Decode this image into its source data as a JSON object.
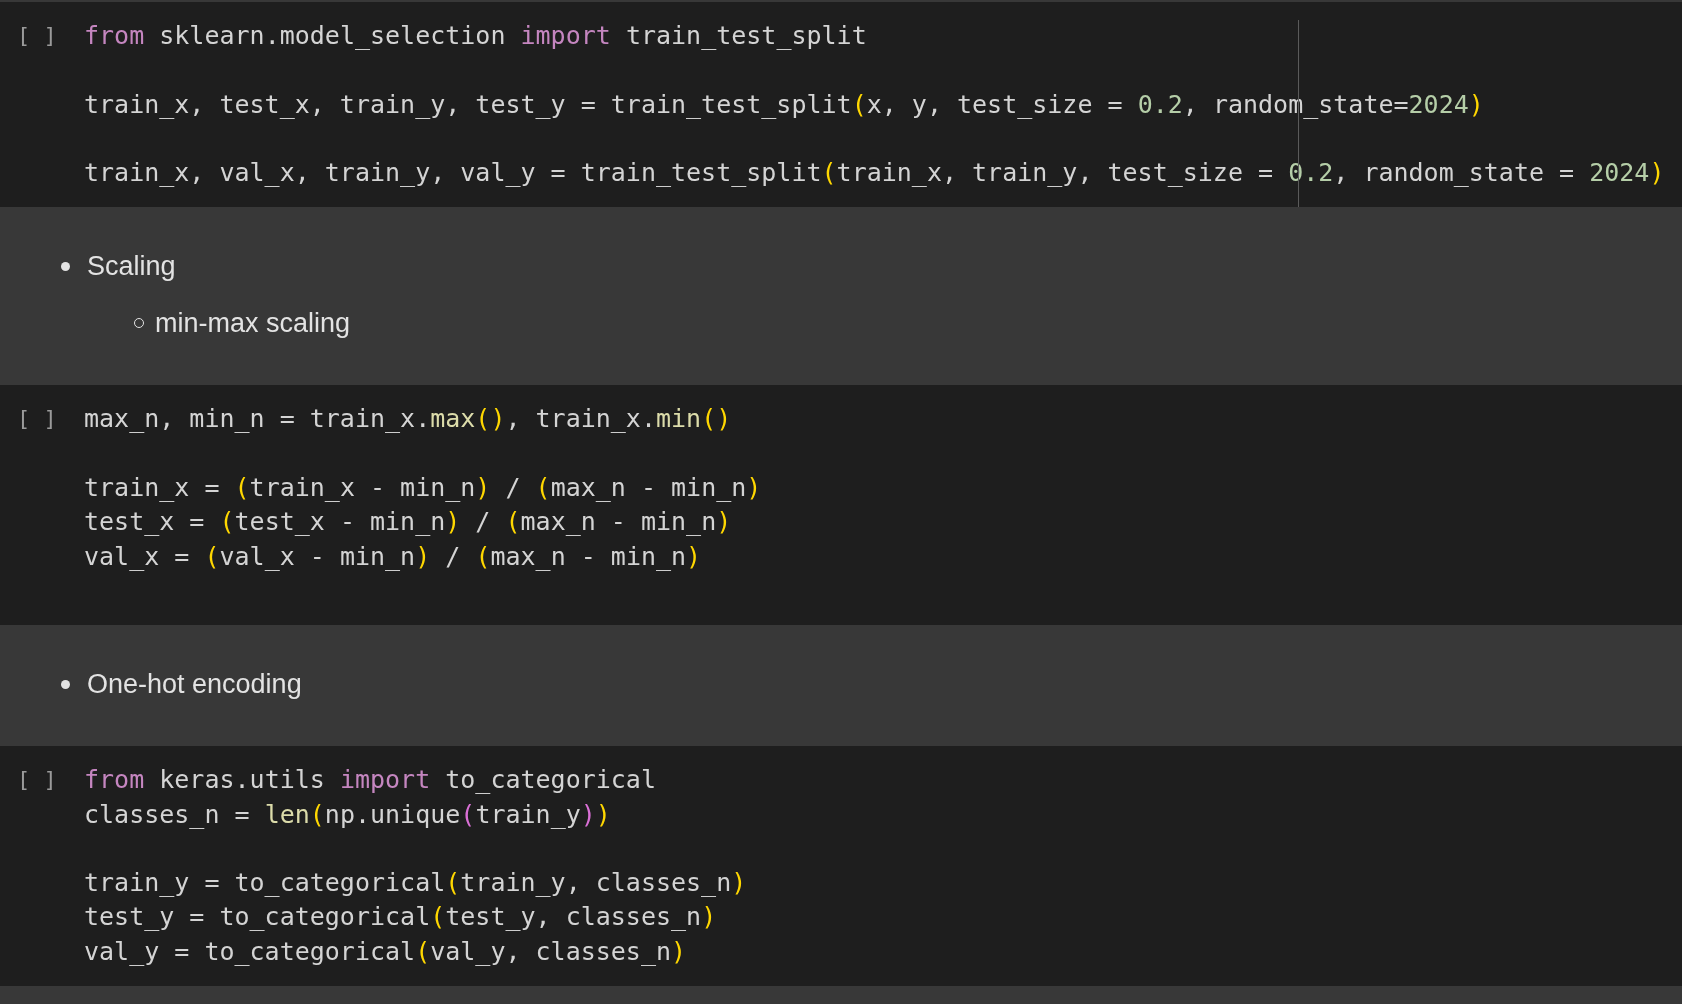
{
  "cells": [
    {
      "kind": "code",
      "run_marker": "[ ]",
      "ruler": true,
      "lines": [
        {
          "kind": "code",
          "tokens": [
            {
              "kind": "keyword",
              "text": "from"
            },
            {
              "kind": "plain",
              "text": " sklearn.model_selection "
            },
            {
              "kind": "keyword",
              "text": "import"
            },
            {
              "kind": "plain",
              "text": " train_test_split"
            }
          ]
        },
        {
          "kind": "blank"
        },
        {
          "kind": "code",
          "tokens": [
            {
              "kind": "plain",
              "text": "train_x, test_x, train_y, test_y = train_test_split"
            },
            {
              "kind": "bracket",
              "text": "("
            },
            {
              "kind": "plain",
              "text": "x, y, test_size = "
            },
            {
              "kind": "number",
              "text": "0.2"
            },
            {
              "kind": "plain",
              "text": ", random_state="
            },
            {
              "kind": "number",
              "text": "2024"
            },
            {
              "kind": "bracket",
              "text": ")"
            }
          ]
        },
        {
          "kind": "blank"
        },
        {
          "kind": "code",
          "tokens": [
            {
              "kind": "plain",
              "text": "train_x, val_x, train_y, val_y = train_test_split"
            },
            {
              "kind": "bracket",
              "text": "("
            },
            {
              "kind": "plain",
              "text": "train_x, train_y, test_size = "
            },
            {
              "kind": "number",
              "text": "0.2"
            },
            {
              "kind": "plain",
              "text": ", random_state = "
            },
            {
              "kind": "number",
              "text": "2024"
            },
            {
              "kind": "bracket",
              "text": ")"
            }
          ]
        }
      ]
    },
    {
      "kind": "markdown",
      "bullets": [
        {
          "text": "Scaling",
          "children": [
            {
              "text": "min-max scaling"
            }
          ]
        }
      ]
    },
    {
      "kind": "code",
      "run_marker": "[ ]",
      "ruler": false,
      "lines": [
        {
          "kind": "code",
          "tokens": [
            {
              "kind": "plain",
              "text": "max_n, min_n = train_x."
            },
            {
              "kind": "function",
              "text": "max"
            },
            {
              "kind": "bracket",
              "text": "()"
            },
            {
              "kind": "plain",
              "text": ", train_x."
            },
            {
              "kind": "function",
              "text": "min"
            },
            {
              "kind": "bracket",
              "text": "()"
            }
          ]
        },
        {
          "kind": "blank"
        },
        {
          "kind": "code",
          "tokens": [
            {
              "kind": "plain",
              "text": "train_x = "
            },
            {
              "kind": "bracket",
              "text": "("
            },
            {
              "kind": "plain",
              "text": "train_x - min_n"
            },
            {
              "kind": "bracket",
              "text": ")"
            },
            {
              "kind": "plain",
              "text": " / "
            },
            {
              "kind": "bracket",
              "text": "("
            },
            {
              "kind": "plain",
              "text": "max_n - min_n"
            },
            {
              "kind": "bracket",
              "text": ")"
            }
          ]
        },
        {
          "kind": "code",
          "tokens": [
            {
              "kind": "plain",
              "text": "test_x = "
            },
            {
              "kind": "bracket",
              "text": "("
            },
            {
              "kind": "plain",
              "text": "test_x - min_n"
            },
            {
              "kind": "bracket",
              "text": ")"
            },
            {
              "kind": "plain",
              "text": " / "
            },
            {
              "kind": "bracket",
              "text": "("
            },
            {
              "kind": "plain",
              "text": "max_n - min_n"
            },
            {
              "kind": "bracket",
              "text": ")"
            }
          ]
        },
        {
          "kind": "code",
          "tokens": [
            {
              "kind": "plain",
              "text": "val_x = "
            },
            {
              "kind": "bracket",
              "text": "("
            },
            {
              "kind": "plain",
              "text": "val_x - min_n"
            },
            {
              "kind": "bracket",
              "text": ")"
            },
            {
              "kind": "plain",
              "text": " / "
            },
            {
              "kind": "bracket",
              "text": "("
            },
            {
              "kind": "plain",
              "text": "max_n - min_n"
            },
            {
              "kind": "bracket",
              "text": ")"
            }
          ]
        },
        {
          "kind": "blank"
        }
      ]
    },
    {
      "kind": "markdown",
      "bullets": [
        {
          "text": "One-hot encoding"
        }
      ]
    },
    {
      "kind": "code",
      "run_marker": "[ ]",
      "ruler": false,
      "lines": [
        {
          "kind": "code",
          "tokens": [
            {
              "kind": "keyword",
              "text": "from"
            },
            {
              "kind": "plain",
              "text": " keras.utils "
            },
            {
              "kind": "keyword",
              "text": "import"
            },
            {
              "kind": "plain",
              "text": " to_categorical"
            }
          ]
        },
        {
          "kind": "code",
          "tokens": [
            {
              "kind": "plain",
              "text": "classes_n = "
            },
            {
              "kind": "function",
              "text": "len"
            },
            {
              "kind": "bracket",
              "text": "("
            },
            {
              "kind": "plain",
              "text": "np.unique"
            },
            {
              "kind": "bracket2",
              "text": "("
            },
            {
              "kind": "plain",
              "text": "train_y"
            },
            {
              "kind": "bracket2",
              "text": ")"
            },
            {
              "kind": "bracket",
              "text": ")"
            }
          ]
        },
        {
          "kind": "blank"
        },
        {
          "kind": "code",
          "tokens": [
            {
              "kind": "plain",
              "text": "train_y = to_categorical"
            },
            {
              "kind": "bracket",
              "text": "("
            },
            {
              "kind": "plain",
              "text": "train_y, classes_n"
            },
            {
              "kind": "bracket",
              "text": ")"
            }
          ]
        },
        {
          "kind": "code",
          "tokens": [
            {
              "kind": "plain",
              "text": "test_y = to_categorical"
            },
            {
              "kind": "bracket",
              "text": "("
            },
            {
              "kind": "plain",
              "text": "test_y, classes_n"
            },
            {
              "kind": "bracket",
              "text": ")"
            }
          ]
        },
        {
          "kind": "code",
          "tokens": [
            {
              "kind": "plain",
              "text": "val_y = to_categorical"
            },
            {
              "kind": "bracket",
              "text": "("
            },
            {
              "kind": "plain",
              "text": "val_y, classes_n"
            },
            {
              "kind": "bracket",
              "text": ")"
            }
          ]
        }
      ]
    }
  ]
}
